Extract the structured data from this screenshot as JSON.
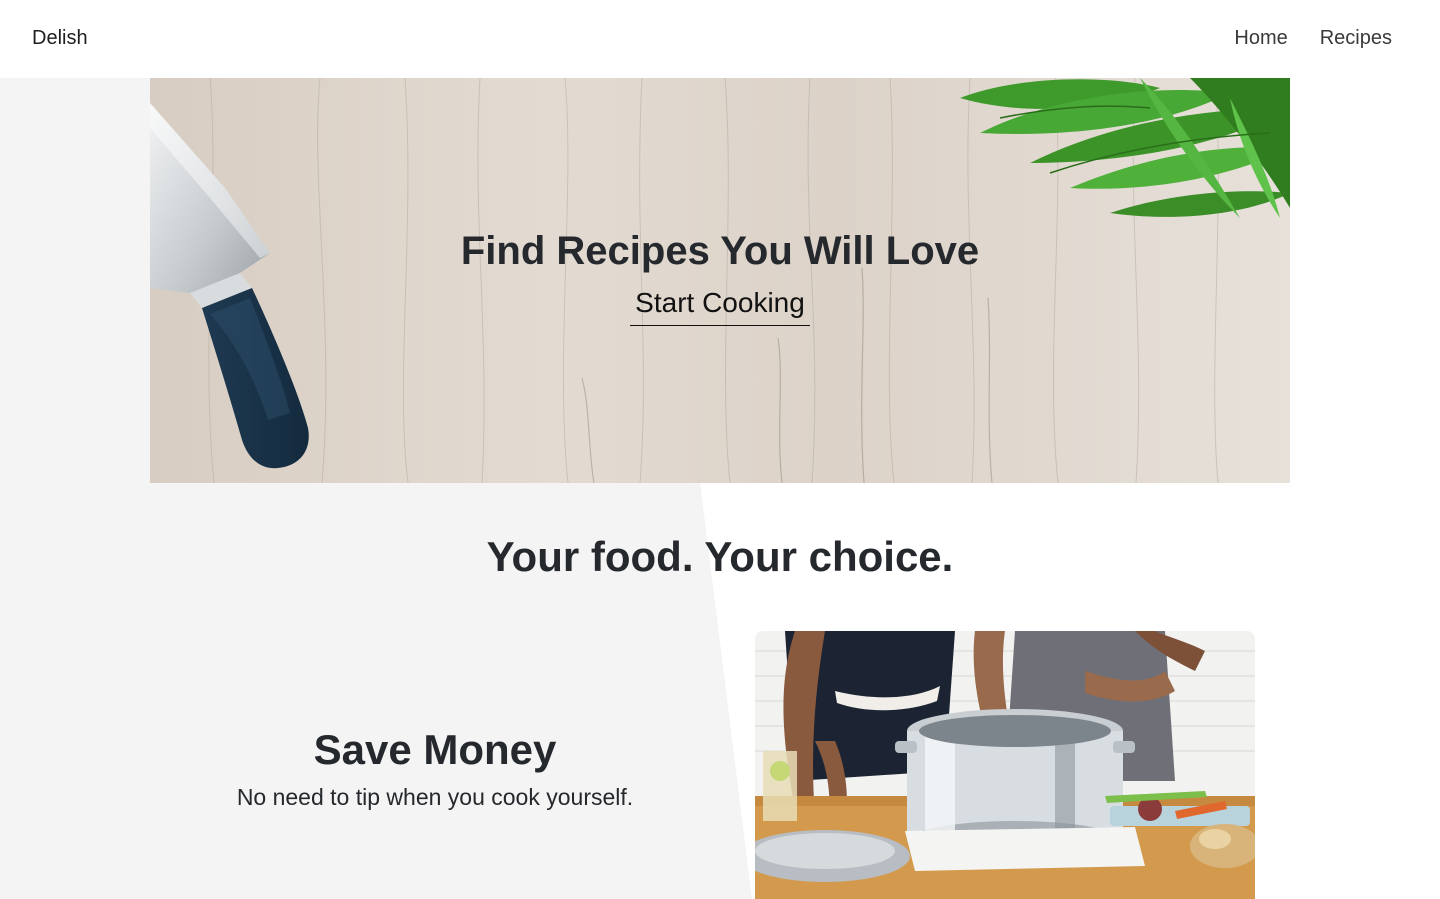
{
  "navbar": {
    "brand": "Delish",
    "links": [
      "Home",
      "Recipes"
    ]
  },
  "hero": {
    "title": "Find Recipes You Will Love",
    "cta": "Start Cooking"
  },
  "section": {
    "title": "Your food. Your choice."
  },
  "feature": {
    "title": "Save Money",
    "description": "No need to tip when you cook yourself."
  },
  "colors": {
    "page_bg_left": "#f4f4f4",
    "page_bg_right": "#ffffff",
    "text": "#25282c",
    "wood": "#ddd3c9"
  }
}
